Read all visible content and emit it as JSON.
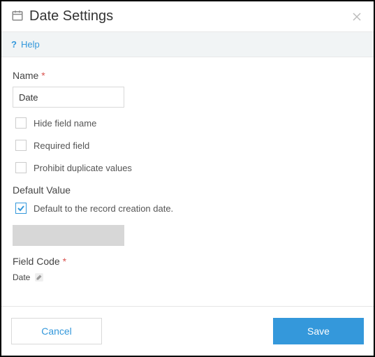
{
  "header": {
    "title": "Date Settings",
    "close_aria": "Close"
  },
  "help": {
    "label": "Help"
  },
  "form": {
    "name": {
      "label": "Name",
      "required_mark": "*",
      "value": "Date"
    },
    "hide_field_name": {
      "label": "Hide field name",
      "checked": false
    },
    "required_field": {
      "label": "Required field",
      "checked": false
    },
    "prohibit_duplicates": {
      "label": "Prohibit duplicate values",
      "checked": false
    },
    "default_value": {
      "label": "Default Value",
      "default_to_creation": {
        "label": "Default to the record creation date.",
        "checked": true
      },
      "value": ""
    },
    "field_code": {
      "label": "Field Code",
      "required_mark": "*",
      "value": "Date"
    }
  },
  "footer": {
    "cancel": "Cancel",
    "save": "Save"
  }
}
